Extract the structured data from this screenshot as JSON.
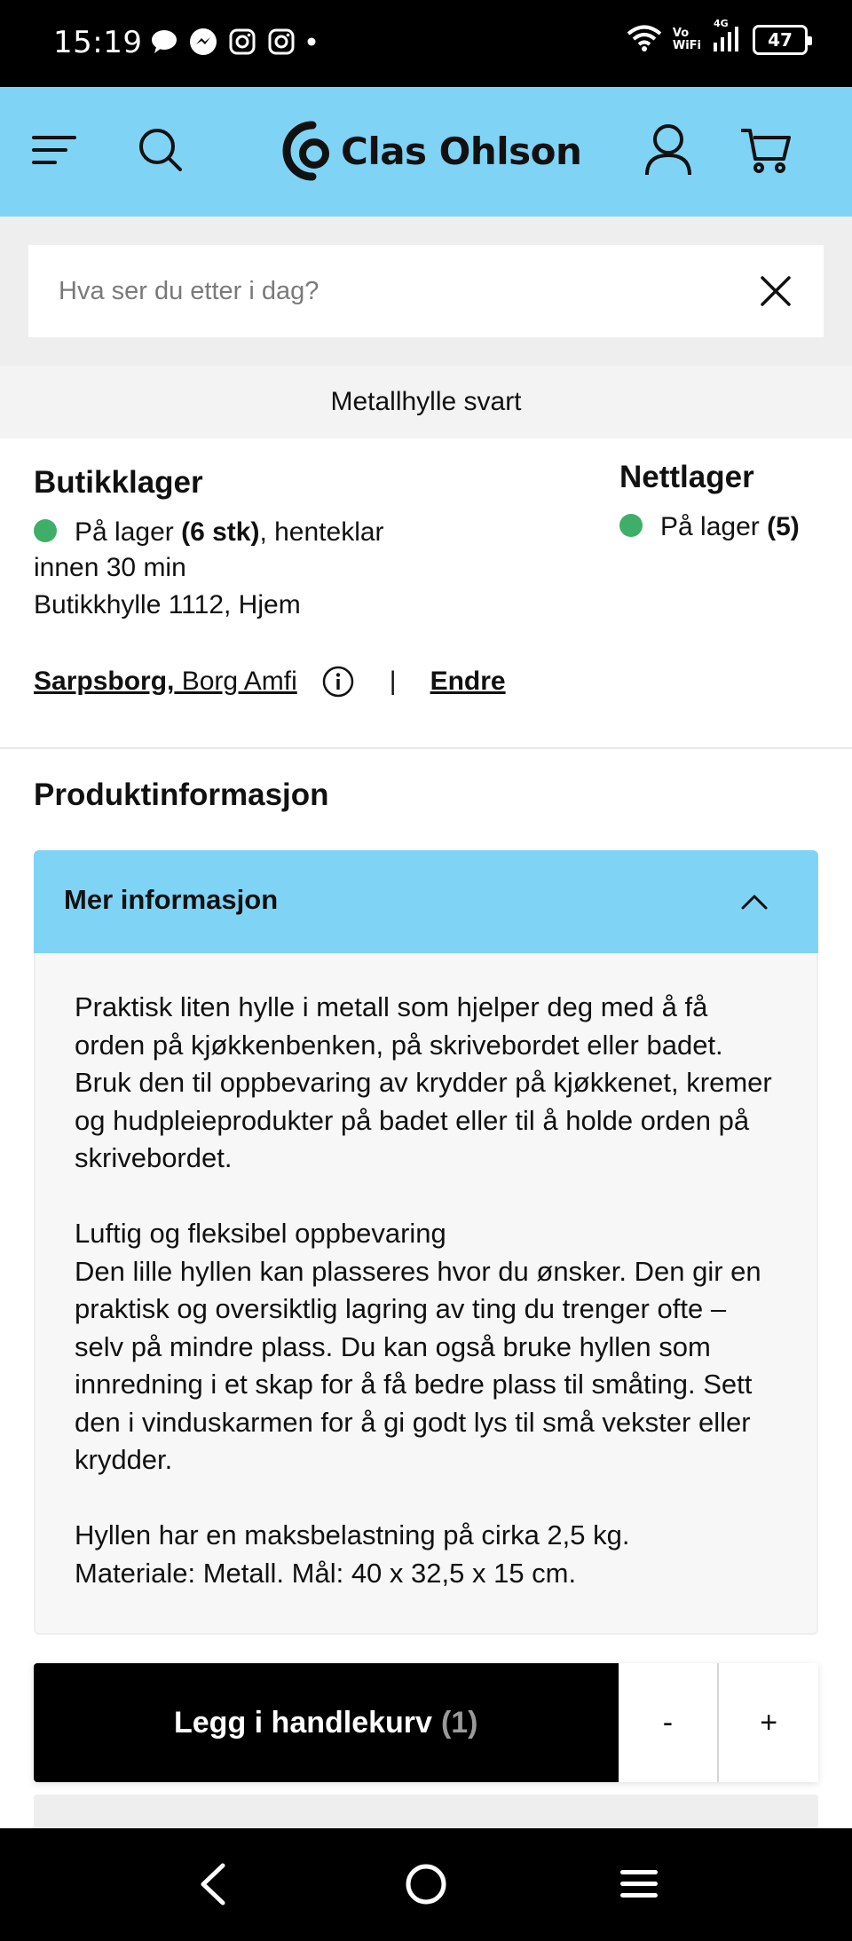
{
  "status_bar": {
    "time": "15:19",
    "network_label": "Vo\nWiFi",
    "network_type": "4G",
    "battery": "47",
    "notification_icons": [
      "chat-bubble-icon",
      "messenger-icon",
      "instagram-icon",
      "instagram-icon",
      "dot-icon"
    ]
  },
  "header": {
    "brand": "Clas Ohlson",
    "icons": [
      "menu-icon",
      "search-icon",
      "user-icon",
      "cart-icon"
    ],
    "brand_color": "#7fd4f6"
  },
  "search": {
    "placeholder": "Hva ser du etter i dag?"
  },
  "product": {
    "title": "Metallhylle svart"
  },
  "stock": {
    "store": {
      "title": "Butikklager",
      "status": "På lager",
      "count": "(6 stk)",
      "pickup": ", henteklar innen 30 min",
      "shelf": "Butikkhylle 1112, Hjem"
    },
    "web": {
      "title": "Nettlager",
      "status": "På lager",
      "count": "(5)"
    },
    "store_name_bold": "Sarpsborg,",
    "store_name_rest": " Borg Amfi",
    "separator": "|",
    "change_label": "Endre",
    "status_color": "#3fae68"
  },
  "product_info": {
    "section_title": "Produktinformasjon",
    "accordion_title": "Mer informasjon",
    "paragraphs": [
      "Praktisk liten hylle i metall som hjelper deg med å få orden på kjøkkenbenken, på skrivebordet eller badet. Bruk den til oppbevaring av krydder på kjøkkenet, kremer og hudpleieprodukter på badet eller til å holde orden på skrivebordet.",
      "Luftig og fleksibel oppbevaring",
      "Den lille hyllen kan plasseres hvor du ønsker. Den gir en praktisk og oversiktlig lagring av ting du trenger ofte – selv på mindre plass. Du kan også bruke hyllen som innredning i et skap for å få bedre plass til småting. Sett den i vinduskarmen for å gi godt lys til små vekster eller krydder.",
      "Hyllen har en maksbelastning på cirka 2,5 kg.",
      "Materiale: Metall. Mål: 40 x 32,5 x 15 cm."
    ]
  },
  "cart": {
    "add_label": "Legg i handlekurv",
    "quantity": "(1)",
    "minus": "-",
    "plus": "+"
  },
  "nav": {
    "icons": [
      "back-icon",
      "home-icon",
      "recents-icon"
    ]
  }
}
